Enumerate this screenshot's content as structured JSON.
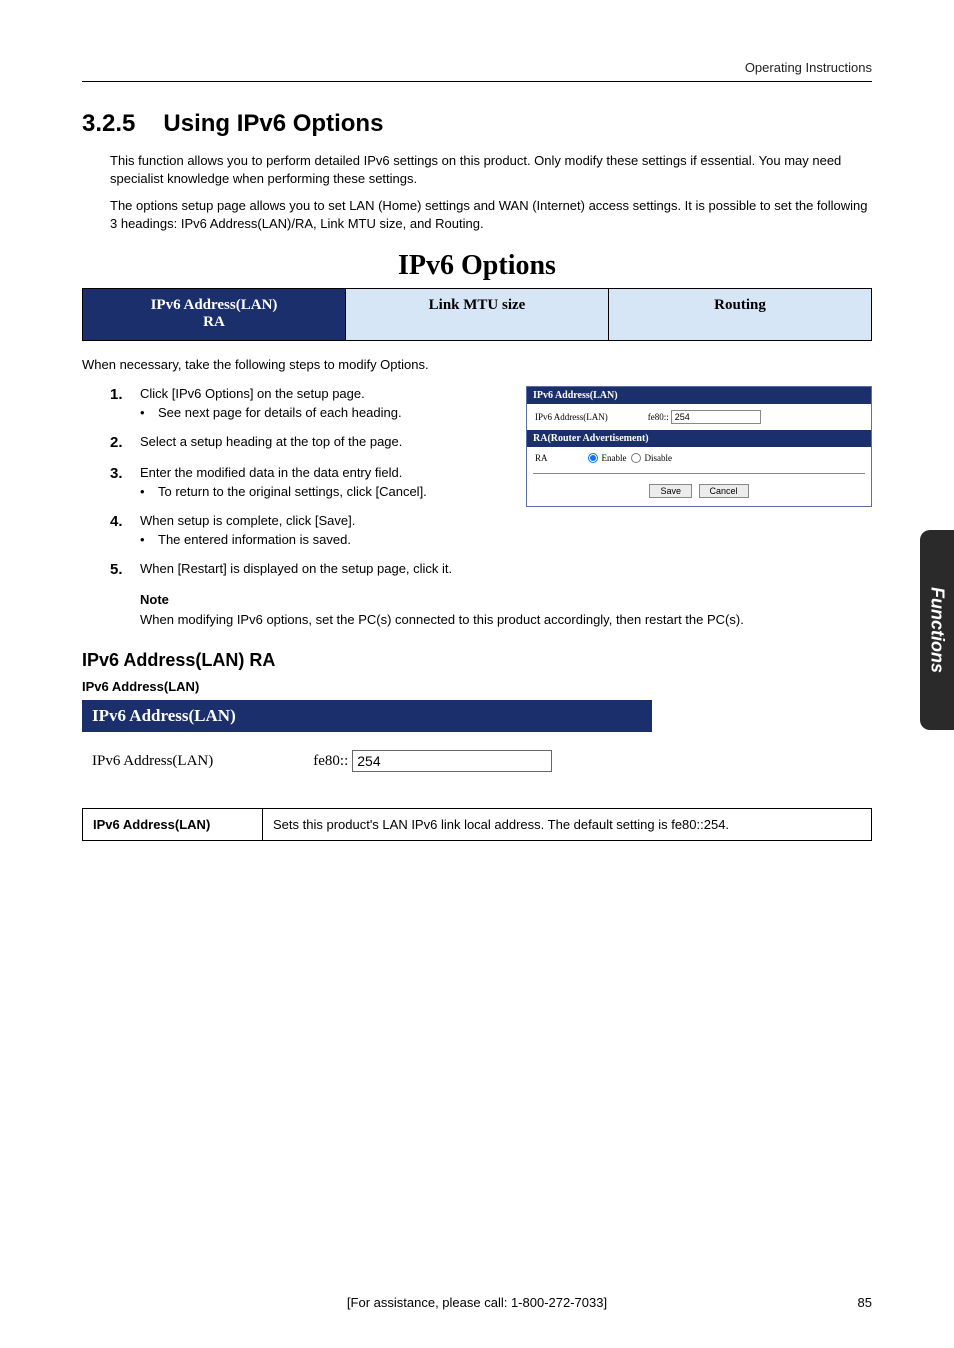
{
  "header": {
    "right": "Operating Instructions"
  },
  "title": {
    "number": "3.2.5",
    "text": "Using IPv6 Options"
  },
  "intro": [
    "This function allows you to perform detailed IPv6 settings on this product. Only modify these settings if essential. You may need specialist knowledge when performing these settings.",
    "The options setup page allows you to set LAN (Home) settings and WAN (Internet) access settings. It is possible to set the following 3 headings: IPv6 Address(LAN)/RA, Link MTU size, and Routing."
  ],
  "banner": {
    "title": "IPv6 Options",
    "tabs": [
      {
        "label_line1": "IPv6 Address(LAN)",
        "label_line2": "RA",
        "active": true
      },
      {
        "label": "Link MTU size",
        "active": false
      },
      {
        "label": "Routing",
        "active": false
      }
    ]
  },
  "when_text": "When necessary, take the following steps to modify Options.",
  "steps": [
    {
      "n": "1.",
      "text": "Click [IPv6 Options] on the setup page.",
      "bullet": "See next page for details of each heading."
    },
    {
      "n": "2.",
      "text": "Select a setup heading at the top of the page."
    },
    {
      "n": "3.",
      "text": "Enter the modified data in the data entry field.",
      "bullet": "To return to the original settings, click [Cancel]."
    },
    {
      "n": "4.",
      "text": "When setup is complete, click [Save].",
      "bullet": "The entered information is saved."
    },
    {
      "n": "5.",
      "text": "When [Restart] is displayed on the setup page, click it."
    }
  ],
  "note": {
    "label": "Note",
    "text": "When modifying IPv6 options, set the PC(s) connected to this product accordingly, then restart the PC(s)."
  },
  "mini": {
    "h1": "IPv6 Address(LAN)",
    "row1_label": "IPv6 Address(LAN)",
    "row1_prefix": "fe80::",
    "row1_value": "254",
    "h2": "RA(Router Advertisement)",
    "row2_label": "RA",
    "row2_opt1": "Enable",
    "row2_opt2": "Disable",
    "btn_save": "Save",
    "btn_cancel": "Cancel"
  },
  "addr_section": {
    "h3": "IPv6 Address(LAN) RA",
    "h4": "IPv6 Address(LAN)",
    "panel_header": "IPv6 Address(LAN)",
    "panel_label": "IPv6 Address(LAN)",
    "panel_prefix": "fe80::",
    "panel_value": "254",
    "table_term": "IPv6 Address(LAN)",
    "table_desc": "Sets this product's LAN IPv6 link local address. The default setting is fe80::254."
  },
  "side_tab": "Functions",
  "footer": {
    "center": "[For assistance, please call: 1-800-272-7033]",
    "right": "85"
  }
}
